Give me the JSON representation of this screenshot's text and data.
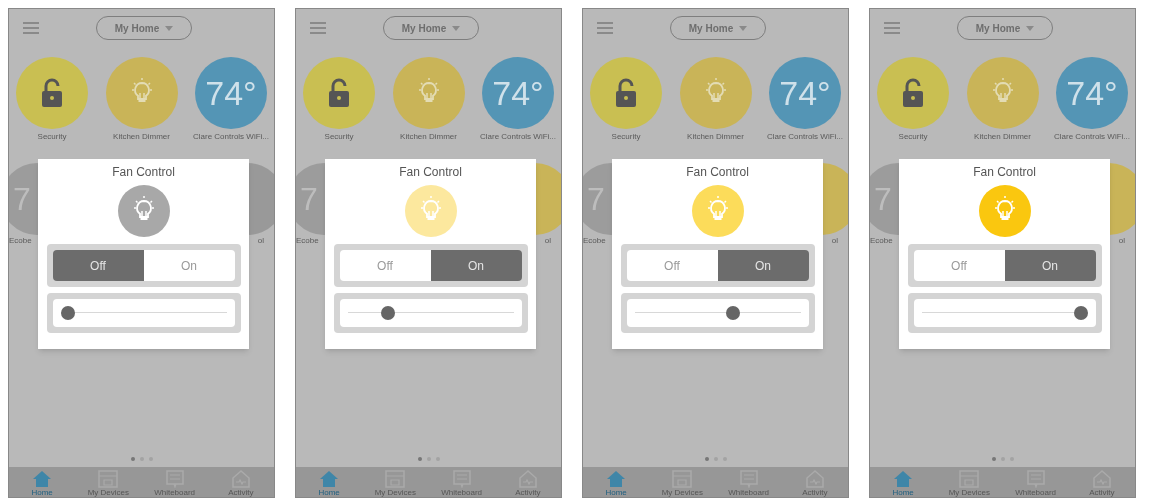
{
  "screens": [
    {
      "home_selector": "My Home",
      "tiles": [
        {
          "label": "Security",
          "kind": "lock",
          "color": "#c9bf52"
        },
        {
          "label": "Kitchen Dimmer",
          "kind": "bulb",
          "color": "#c9b458"
        },
        {
          "label": "Clare Controls WiFi...",
          "kind": "temperature",
          "value": "74°",
          "color": "#5495b5"
        }
      ],
      "second_row": {
        "left_label": "Ecobe",
        "left_value": "7",
        "right_label": "ol",
        "color": "#999999"
      },
      "dialog": {
        "title": "Fan Control",
        "color": "#a8a8a8",
        "options": [
          {
            "label": "Off",
            "selected": true
          },
          {
            "label": "On",
            "selected": false
          }
        ],
        "level": 0
      },
      "pages": [
        {
          "selected": true
        },
        {
          "selected": false
        },
        {
          "selected": false
        }
      ],
      "nav": [
        {
          "label": "Home",
          "kind": "home",
          "selected": true
        },
        {
          "label": "My Devices",
          "kind": "devices",
          "selected": false
        },
        {
          "label": "Whiteboard",
          "kind": "board",
          "selected": false
        },
        {
          "label": "Activity",
          "kind": "activity",
          "selected": false
        }
      ]
    },
    {
      "home_selector": "My Home",
      "tiles": [
        {
          "label": "Security",
          "kind": "lock",
          "color": "#c9bf52"
        },
        {
          "label": "Kitchen Dimmer",
          "kind": "bulb",
          "color": "#c9b458"
        },
        {
          "label": "Clare Controls WiFi...",
          "kind": "temperature",
          "value": "74°",
          "color": "#5495b5"
        }
      ],
      "second_row": {
        "left_label": "Ecobe",
        "left_value": "7",
        "right_label": "ol",
        "color": "#c9b458"
      },
      "dialog": {
        "title": "Fan Control",
        "color": "#fce89e",
        "options": [
          {
            "label": "Off",
            "selected": false
          },
          {
            "label": "On",
            "selected": true
          }
        ],
        "level": 0.22
      },
      "pages": [
        {
          "selected": true
        },
        {
          "selected": false
        },
        {
          "selected": false
        }
      ],
      "nav": [
        {
          "label": "Home",
          "kind": "home",
          "selected": true
        },
        {
          "label": "My Devices",
          "kind": "devices",
          "selected": false
        },
        {
          "label": "Whiteboard",
          "kind": "board",
          "selected": false
        },
        {
          "label": "Activity",
          "kind": "activity",
          "selected": false
        }
      ]
    },
    {
      "home_selector": "My Home",
      "tiles": [
        {
          "label": "Security",
          "kind": "lock",
          "color": "#c9bf52"
        },
        {
          "label": "Kitchen Dimmer",
          "kind": "bulb",
          "color": "#c9b458"
        },
        {
          "label": "Clare Controls WiFi...",
          "kind": "temperature",
          "value": "74°",
          "color": "#5495b5"
        }
      ],
      "second_row": {
        "left_label": "Ecobe",
        "left_value": "7",
        "right_label": "ol",
        "color": "#c9b458"
      },
      "dialog": {
        "title": "Fan Control",
        "color": "#fcdc5a",
        "options": [
          {
            "label": "Off",
            "selected": false
          },
          {
            "label": "On",
            "selected": true
          }
        ],
        "level": 0.6
      },
      "pages": [
        {
          "selected": true
        },
        {
          "selected": false
        },
        {
          "selected": false
        }
      ],
      "nav": [
        {
          "label": "Home",
          "kind": "home",
          "selected": true
        },
        {
          "label": "My Devices",
          "kind": "devices",
          "selected": false
        },
        {
          "label": "Whiteboard",
          "kind": "board",
          "selected": false
        },
        {
          "label": "Activity",
          "kind": "activity",
          "selected": false
        }
      ]
    },
    {
      "home_selector": "My Home",
      "tiles": [
        {
          "label": "Security",
          "kind": "lock",
          "color": "#c9bf52"
        },
        {
          "label": "Kitchen Dimmer",
          "kind": "bulb",
          "color": "#c9b458"
        },
        {
          "label": "Clare Controls WiFi...",
          "kind": "temperature",
          "value": "74°",
          "color": "#5495b5"
        }
      ],
      "second_row": {
        "left_label": "Ecobe",
        "left_value": "7",
        "right_label": "ol",
        "color": "#c9b458"
      },
      "dialog": {
        "title": "Fan Control",
        "color": "#fac70f",
        "options": [
          {
            "label": "Off",
            "selected": false
          },
          {
            "label": "On",
            "selected": true
          }
        ],
        "level": 1
      },
      "pages": [
        {
          "selected": true
        },
        {
          "selected": false
        },
        {
          "selected": false
        }
      ],
      "nav": [
        {
          "label": "Home",
          "kind": "home",
          "selected": true
        },
        {
          "label": "My Devices",
          "kind": "devices",
          "selected": false
        },
        {
          "label": "Whiteboard",
          "kind": "board",
          "selected": false
        },
        {
          "label": "Activity",
          "kind": "activity",
          "selected": false
        }
      ]
    }
  ]
}
